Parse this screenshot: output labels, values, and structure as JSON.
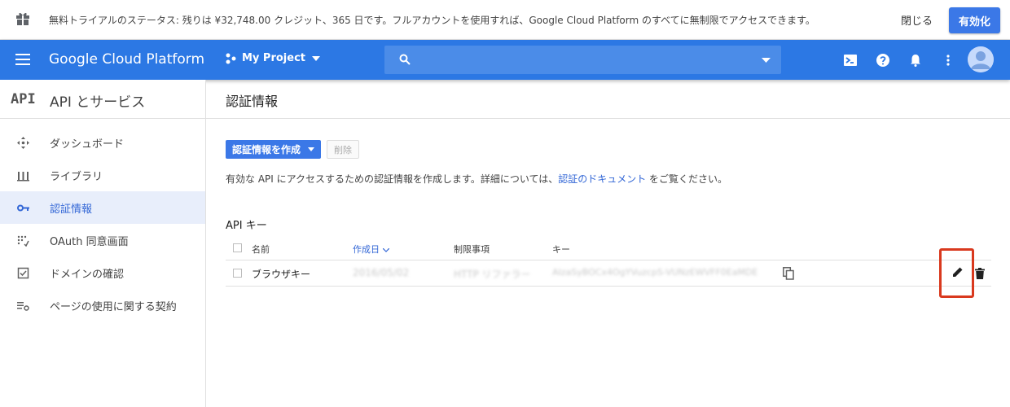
{
  "banner": {
    "icon": "gift-icon",
    "message": "無料トライアルのステータス: 残りは ¥32,748.00 クレジット、365 日です。フルアカウントを使用すれば、Google Cloud Platform のすべてに無制限でアクセスできます。",
    "close_label": "閉じる",
    "enable_label": "有効化"
  },
  "appbar": {
    "brand": "Google Cloud Platform",
    "project": "My Project",
    "search_placeholder": "",
    "color": "#2c78e4"
  },
  "sidebar": {
    "logo": "API",
    "title": "API とサービス",
    "items": [
      {
        "label": "ダッシュボード",
        "icon": "dashboard-icon",
        "active": false
      },
      {
        "label": "ライブラリ",
        "icon": "library-icon",
        "active": false
      },
      {
        "label": "認証情報",
        "icon": "key-icon",
        "active": true
      },
      {
        "label": "OAuth 同意画面",
        "icon": "consent-icon",
        "active": false
      },
      {
        "label": "ドメインの確認",
        "icon": "checkbox-icon",
        "active": false
      },
      {
        "label": "ページの使用に関する契約",
        "icon": "settings-list-icon",
        "active": false
      }
    ]
  },
  "main": {
    "title": "認証情報",
    "create_label": "認証情報を作成",
    "delete_label": "削除",
    "description_prefix": "有効な API にアクセスするための認証情報を作成します。詳細については、",
    "description_link": "認証のドキュメント",
    "description_suffix": " をご覧ください。",
    "section_title": "API キー",
    "table": {
      "headers": {
        "name": "名前",
        "created": "作成日",
        "restriction": "制限事項",
        "key": "キー"
      },
      "rows": [
        {
          "name": "ブラウザキー",
          "created": "2016/05/02",
          "restriction": "HTTP リファラー",
          "key": "AIzaSyBOCx4OgYVuzcpS-VUNzEWVFF0EaMDE"
        }
      ]
    }
  },
  "colors": {
    "accent": "#3b78e7",
    "highlight": "#d9391e",
    "active_bg": "#e8eefb"
  }
}
